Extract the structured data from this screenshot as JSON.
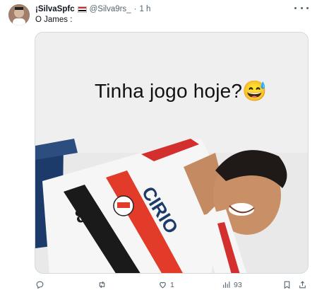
{
  "tweet": {
    "display_name": "¡SilvaSpfc",
    "handle": "@Silva9rs_",
    "separator": "·",
    "time": "1 h",
    "text": "O James :"
  },
  "media": {
    "caption": "Tinha jogo hoje?",
    "emoji": "😅",
    "jersey_number": "8",
    "jersey_sponsor": "CIRIO"
  },
  "actions": {
    "reply_count": "",
    "retweet_count": "",
    "like_count": "1",
    "views_count": "93"
  },
  "icons": {
    "reply": "reply-icon",
    "retweet": "retweet-icon",
    "like": "heart-icon",
    "views": "views-icon",
    "bookmark": "bookmark-icon",
    "share": "share-icon",
    "more": "more-icon"
  },
  "colors": {
    "text": "#0f1419",
    "secondary": "#536471",
    "border": "#cfd9de"
  }
}
